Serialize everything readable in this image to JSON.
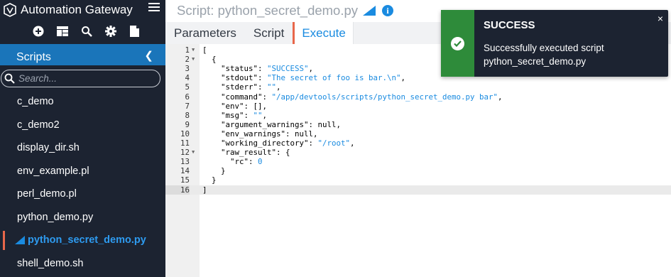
{
  "app": {
    "title": "Automation Gateway"
  },
  "toolbar": {
    "icons": [
      "add-icon",
      "grid-icon",
      "search-icon",
      "gear-icon",
      "document-icon"
    ]
  },
  "sidebar": {
    "section_title": "Scripts",
    "search_placeholder": "Search...",
    "items": [
      {
        "label": "c_demo"
      },
      {
        "label": "c_demo2"
      },
      {
        "label": "display_dir.sh"
      },
      {
        "label": "env_example.pl"
      },
      {
        "label": "perl_demo.pl"
      },
      {
        "label": "python_demo.py"
      },
      {
        "label": "python_secret_demo.py",
        "active": true
      },
      {
        "label": "shell_demo.sh"
      }
    ]
  },
  "header": {
    "title": "Script: python_secret_demo.py"
  },
  "tabs": [
    {
      "label": "Parameters"
    },
    {
      "label": "Script"
    },
    {
      "label": "Execute",
      "active": true
    }
  ],
  "editor": {
    "lines": [
      "[",
      "  {",
      "    \"status\": \"SUCCESS\",",
      "    \"stdout\": \"The secret of foo is bar.\\n\",",
      "    \"stderr\": \"\",",
      "    \"command\": \"/app/devtools/scripts/python_secret_demo.py bar\",",
      "    \"env\": [],",
      "    \"msg\": \"\",",
      "    \"argument_warnings\": null,",
      "    \"env_warnings\": null,",
      "    \"working_directory\": \"/root\",",
      "    \"raw_result\": {",
      "      \"rc\": 0",
      "    }",
      "  }",
      "]"
    ],
    "fold_lines": [
      1,
      2,
      12
    ],
    "current_line": 16
  },
  "toast": {
    "title": "SUCCESS",
    "message_line1": "Successfully executed script",
    "message_line2": "python_secret_demo.py",
    "close": "×"
  },
  "colors": {
    "accent": "#1a8be0",
    "sidebar": "#1c2331",
    "section": "#1a75ba",
    "success": "#2e8b3a",
    "active_marker": "#e8674a"
  }
}
